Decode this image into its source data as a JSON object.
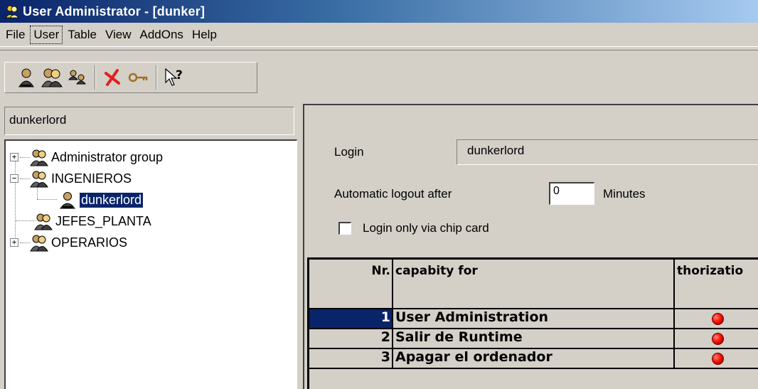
{
  "window": {
    "title": "User Administrator - [dunker]"
  },
  "menu": [
    "File",
    "User",
    "Table",
    "View",
    "AddOns",
    "Help"
  ],
  "toolbar": {
    "icons": [
      "user-icon",
      "user-group-icon",
      "users-icon",
      "delete-icon",
      "key-icon",
      "help-icon"
    ]
  },
  "path_field": "dunkerlord",
  "tree": {
    "items": [
      {
        "label": "Administrator group",
        "expander": "+"
      },
      {
        "label": "INGENIEROS",
        "expander": "−"
      },
      {
        "label": "dunkerlord",
        "selected": true
      },
      {
        "label": "JEFES_PLANTA"
      },
      {
        "label": "OPERARIOS",
        "expander": "+"
      }
    ]
  },
  "form": {
    "login_label": "Login",
    "login_value": "dunkerlord",
    "logout_label": "Automatic logout after",
    "logout_value": "0",
    "minutes_label": "Minutes",
    "chipcard_label": "Login only via chip card"
  },
  "grid": {
    "headers": {
      "nr": "Nr.",
      "capability": "capabity for",
      "authorization": "thorizatio"
    },
    "rows": [
      {
        "nr": "1",
        "capability": "User Administration",
        "authorized": true
      },
      {
        "nr": "2",
        "capability": "Salir de Runtime",
        "authorized": true
      },
      {
        "nr": "3",
        "capability": "Apagar el ordenador",
        "authorized": true
      }
    ]
  },
  "colors": {
    "title_start": "#0a246a",
    "selection": "#0a246a",
    "window_bg": "#d4d0c8",
    "led_red": "#ff1a0a"
  }
}
